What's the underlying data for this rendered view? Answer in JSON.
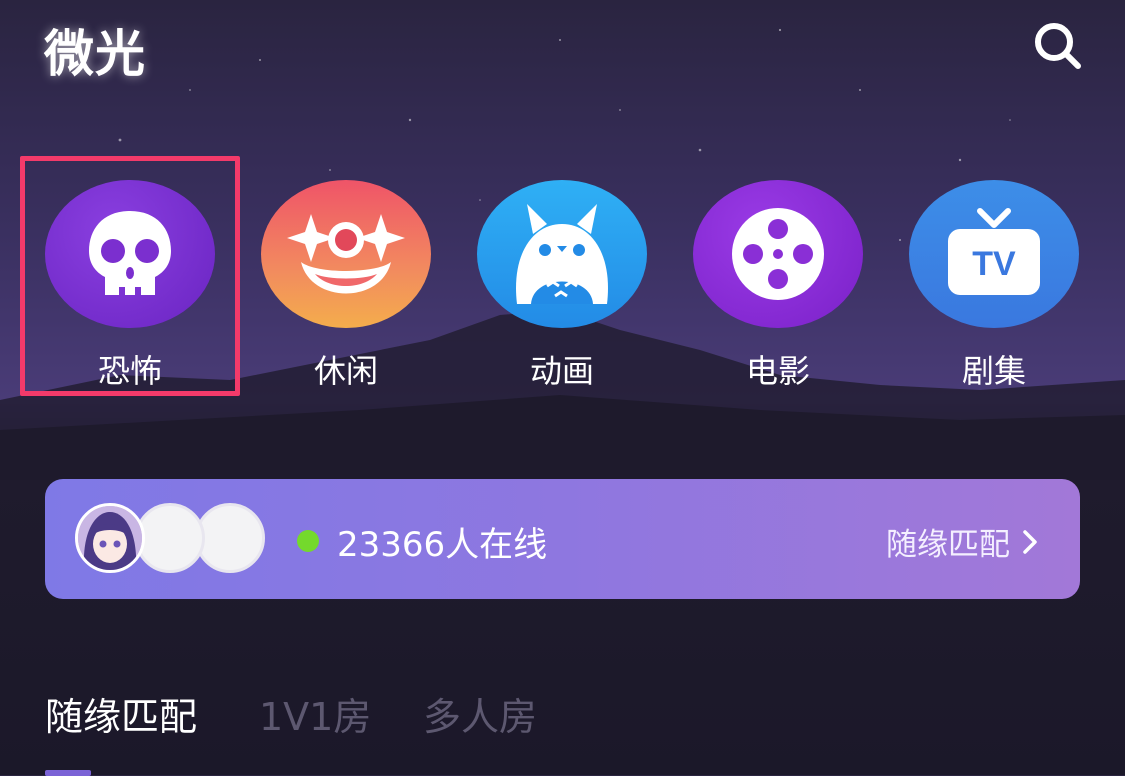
{
  "header": {
    "app_title": "微光",
    "search_icon": "search-icon"
  },
  "categories": [
    {
      "label": "恐怖",
      "icon": "skull-icon",
      "color": "#7b2fcf",
      "selected": true
    },
    {
      "label": "休闲",
      "icon": "clown-face-icon",
      "color": "#f0686a",
      "selected": false
    },
    {
      "label": "动画",
      "icon": "totoro-icon",
      "color": "#2b9bf0",
      "selected": false
    },
    {
      "label": "电影",
      "icon": "film-reel-icon",
      "color": "#8a2fd6",
      "selected": false
    },
    {
      "label": "剧集",
      "icon": "tv-icon",
      "color": "#3f86e6",
      "selected": false
    }
  ],
  "online_bar": {
    "online_text": "23366人在线",
    "match_label": "随缘匹配",
    "status_color": "#74d92c"
  },
  "tabs": [
    {
      "label": "随缘匹配",
      "active": true
    },
    {
      "label": "1V1房",
      "active": false
    },
    {
      "label": "多人房",
      "active": false
    }
  ],
  "colors": {
    "highlight": "#f33a6a",
    "bar_gradient_start": "#7f79e6",
    "bar_gradient_end": "#a278d8"
  }
}
